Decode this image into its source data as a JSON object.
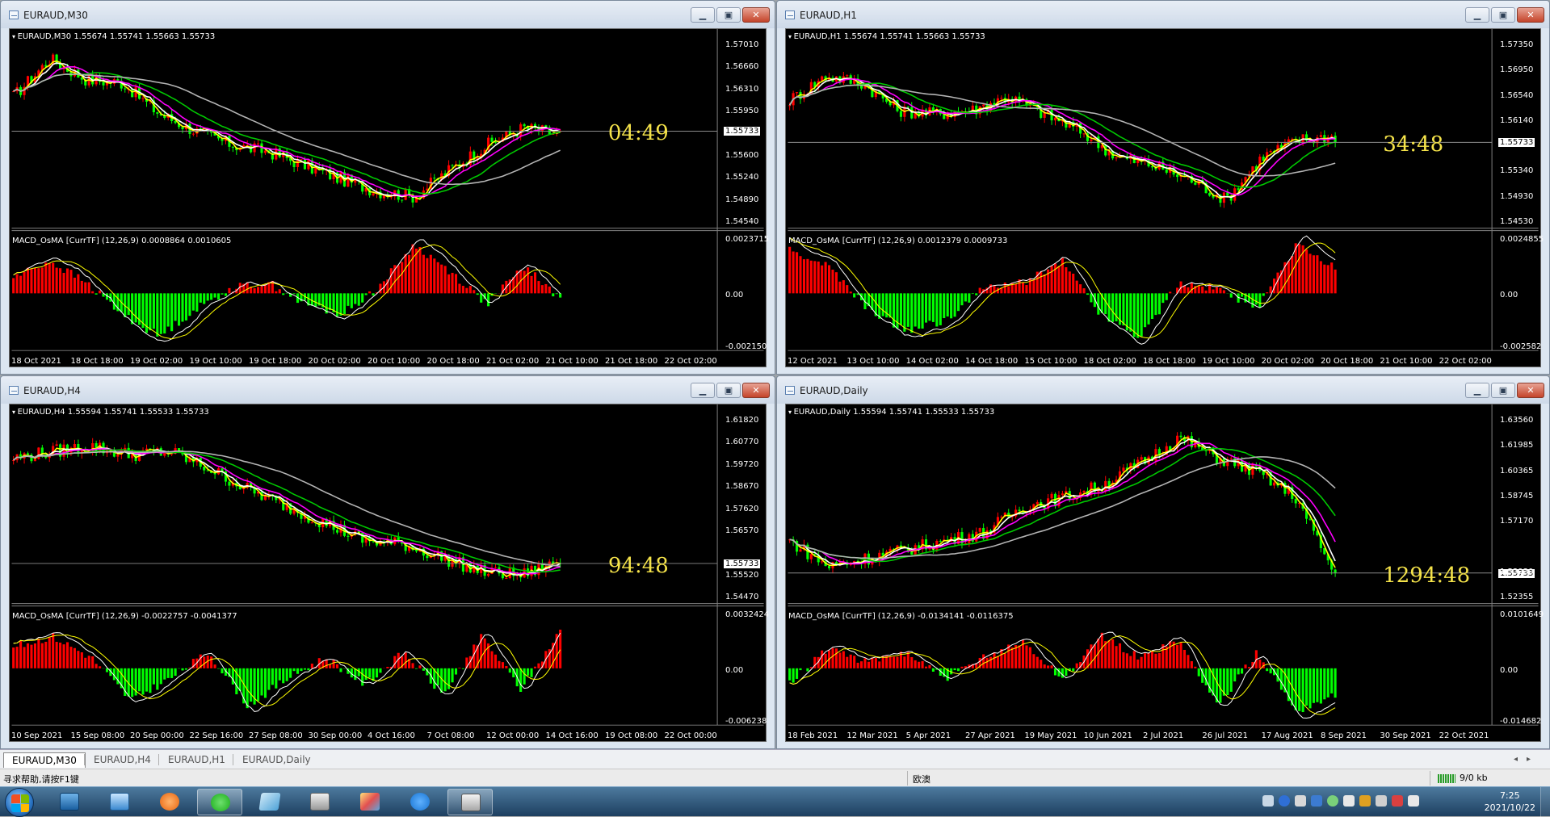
{
  "windows": [
    {
      "title": "EURAUD,M30",
      "header": "EURAUD,M30  1.55674 1.55741 1.55663 1.55733",
      "indicator": "MACD_OsMA [CurrTF] (12,26,9) 0.0008864 0.0010605",
      "countdown": "04:49",
      "price_scale": [
        "1.57010",
        "1.56660",
        "1.56310",
        "1.55950",
        "1.55733",
        "1.55600",
        "1.55240",
        "1.54890",
        "1.54540"
      ],
      "current_price": "1.55733",
      "macd_scale": [
        "0.0023715",
        "0.00",
        "-0.002150"
      ],
      "time_labels": [
        "18 Oct 2021",
        "18 Oct 18:00",
        "19 Oct 02:00",
        "19 Oct 10:00",
        "19 Oct 18:00",
        "20 Oct 02:00",
        "20 Oct 10:00",
        "20 Oct 18:00",
        "21 Oct 02:00",
        "21 Oct 10:00",
        "21 Oct 18:00",
        "22 Oct 02:00"
      ]
    },
    {
      "title": "EURAUD,H1",
      "header": "EURAUD,H1  1.55674 1.55741 1.55663 1.55733",
      "indicator": "MACD_OsMA [CurrTF] (12,26,9) 0.0012379 0.0009733",
      "countdown": "34:48",
      "price_scale": [
        "1.57350",
        "1.56950",
        "1.56540",
        "1.56140",
        "1.55733",
        "1.55340",
        "1.54930",
        "1.54530"
      ],
      "current_price": "1.55733",
      "macd_scale": [
        "0.0024855",
        "0.00",
        "-0.002582"
      ],
      "time_labels": [
        "12 Oct 2021",
        "13 Oct 10:00",
        "14 Oct 02:00",
        "14 Oct 18:00",
        "15 Oct 10:00",
        "18 Oct 02:00",
        "18 Oct 18:00",
        "19 Oct 10:00",
        "20 Oct 02:00",
        "20 Oct 18:00",
        "21 Oct 10:00",
        "22 Oct 02:00"
      ]
    },
    {
      "title": "EURAUD,H4",
      "header": "EURAUD,H4  1.55594 1.55741 1.55533 1.55733",
      "indicator": "MACD_OsMA [CurrTF] (12,26,9) -0.0022757 -0.0041377",
      "countdown": "94:48",
      "price_scale": [
        "1.61820",
        "1.60770",
        "1.59720",
        "1.58670",
        "1.57620",
        "1.56570",
        "1.55733",
        "1.55520",
        "1.54470"
      ],
      "current_price": "1.55733",
      "macd_scale": [
        "0.0032424",
        "0.00",
        "-0.006238"
      ],
      "time_labels": [
        "10 Sep 2021",
        "15 Sep 08:00",
        "20 Sep 00:00",
        "22 Sep 16:00",
        "27 Sep 08:00",
        "30 Sep 00:00",
        "4 Oct 16:00",
        "7 Oct 08:00",
        "12 Oct 00:00",
        "14 Oct 16:00",
        "19 Oct 08:00",
        "22 Oct 00:00"
      ]
    },
    {
      "title": "EURAUD,Daily",
      "header": "EURAUD,Daily  1.55594 1.55741 1.55533 1.55733",
      "indicator": "MACD_OsMA [CurrTF] (12,26,9) -0.0134141 -0.0116375",
      "countdown": "1294:48",
      "price_scale": [
        "1.63560",
        "1.61985",
        "1.60365",
        "1.58745",
        "1.57170",
        "1.55733",
        "1.53930",
        "1.52355"
      ],
      "current_price": "1.55733",
      "macd_scale": [
        "0.0101649",
        "0.00",
        "-0.014682"
      ],
      "time_labels": [
        "18 Feb 2021",
        "12 Mar 2021",
        "5 Apr 2021",
        "27 Apr 2021",
        "19 May 2021",
        "10 Jun 2021",
        "2 Jul 2021",
        "26 Jul 2021",
        "17 Aug 2021",
        "8 Sep 2021",
        "30 Sep 2021",
        "22 Oct 2021"
      ]
    }
  ],
  "tabs": [
    "EURAUD,M30",
    "EURAUD,H4",
    "EURAUD,H1",
    "EURAUD,Daily"
  ],
  "status": {
    "help": "寻求帮助,请按F1键",
    "profile": "欧澳",
    "traffic": "9/0 kb"
  },
  "clock": {
    "time": "7:25",
    "date": "2021/10/22"
  },
  "colors": {
    "bull": "#ff0000",
    "bear": "#00ff00",
    "ma_fast": "#ffff00",
    "ma_white": "#ffffff",
    "ma_magenta": "#ff00ff",
    "ma_green": "#00c800",
    "ma_gray": "#b4b4b4",
    "countdown": "#f5e34a"
  },
  "icons": {
    "window": "chart-window-icon",
    "minimize": "minimize-icon",
    "maximize": "restore-icon",
    "close": "close-icon"
  }
}
